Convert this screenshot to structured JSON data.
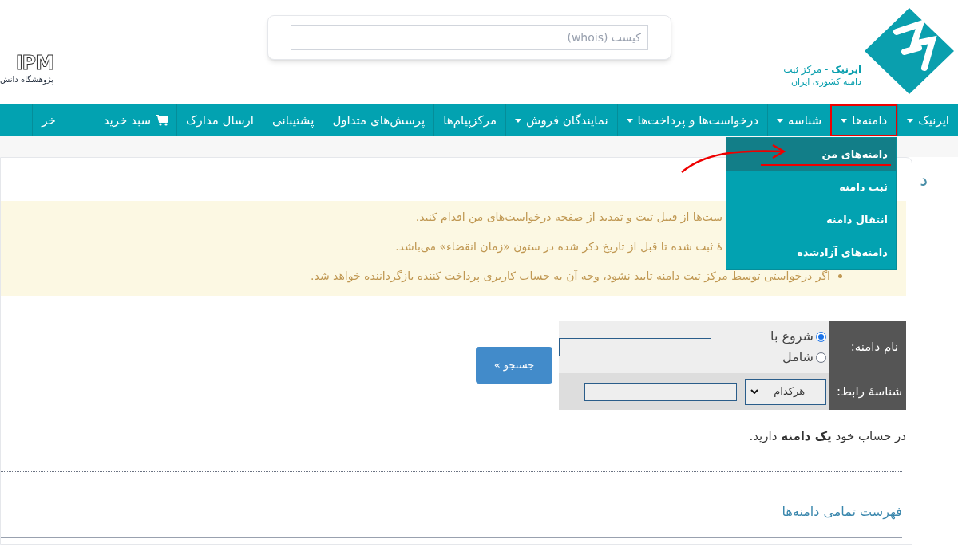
{
  "header": {
    "brand_name": "ایرنیک",
    "brand_suffix": " - مرکز ثبت",
    "brand_sub": "دامنه کشوری ایران",
    "whois": {
      "placeholder": "کیست (whois)"
    },
    "partner_logo": "IPM",
    "partner_name": "پژوهشگاه دانش‌"
  },
  "nav": [
    {
      "label": "ایرنیک",
      "caret": true,
      "selected": false
    },
    {
      "label": "دامنه‌ها",
      "caret": true,
      "selected": true
    },
    {
      "label": "شناسه",
      "caret": true,
      "selected": false
    },
    {
      "label": "درخواست‌ها و پرداخت‌ها",
      "caret": true,
      "selected": false
    },
    {
      "label": "نمایندگان فروش",
      "caret": true,
      "selected": false
    },
    {
      "label": "مرکزپیام‌ها",
      "caret": false,
      "selected": false
    },
    {
      "label": "پرسش‌های متداول",
      "caret": false,
      "selected": false
    },
    {
      "label": "پشتیبانی",
      "caret": false,
      "selected": false
    },
    {
      "label": "ارسال مدارک",
      "caret": false,
      "selected": false
    },
    {
      "label": "سبد خرید",
      "caret": false,
      "selected": false,
      "kind": "cart"
    },
    {
      "label": "خر",
      "caret": false,
      "selected": false
    }
  ],
  "dropdown": [
    {
      "label": "دامنه‌های من",
      "selected": true
    },
    {
      "label": "ثبت دامنه",
      "selected": false
    },
    {
      "label": "انتقال دامنه",
      "selected": false
    },
    {
      "label": "دامنه‌های آزادشده",
      "selected": false
    }
  ],
  "heading": "د",
  "notice": [
    {
      "kind": "cut",
      "text": "ست‌ها از قبیل ثبت و تمدید از صفحه درخواست‌های من اقدام کنید."
    },
    {
      "kind": "cut",
      "text": "ۀ ثبت شده تا قبل از تاریخ ذکر شده در ستون «زمان انقضاء» می‌باشد."
    },
    {
      "kind": "bullet",
      "text": "اگر درخواستی توسط مرکز ثبت دامنه تایید نشود، وجه آن به حساب کاربری پرداخت کننده بازگرداننده خواهد شد."
    }
  ],
  "search_form": {
    "domain_label": "نام دامنه:",
    "match_options": [
      {
        "label": "شروع با",
        "selected": true
      },
      {
        "label": "شامل",
        "selected": false
      }
    ],
    "contact_label": "شناسۀ رابط:",
    "contact_select": "هرکدام",
    "button": "جستجو »"
  },
  "summary": "در حساب خود **یک دامنه** دارید.",
  "list_link": "فهرست تمامی دامنه‌ها"
}
